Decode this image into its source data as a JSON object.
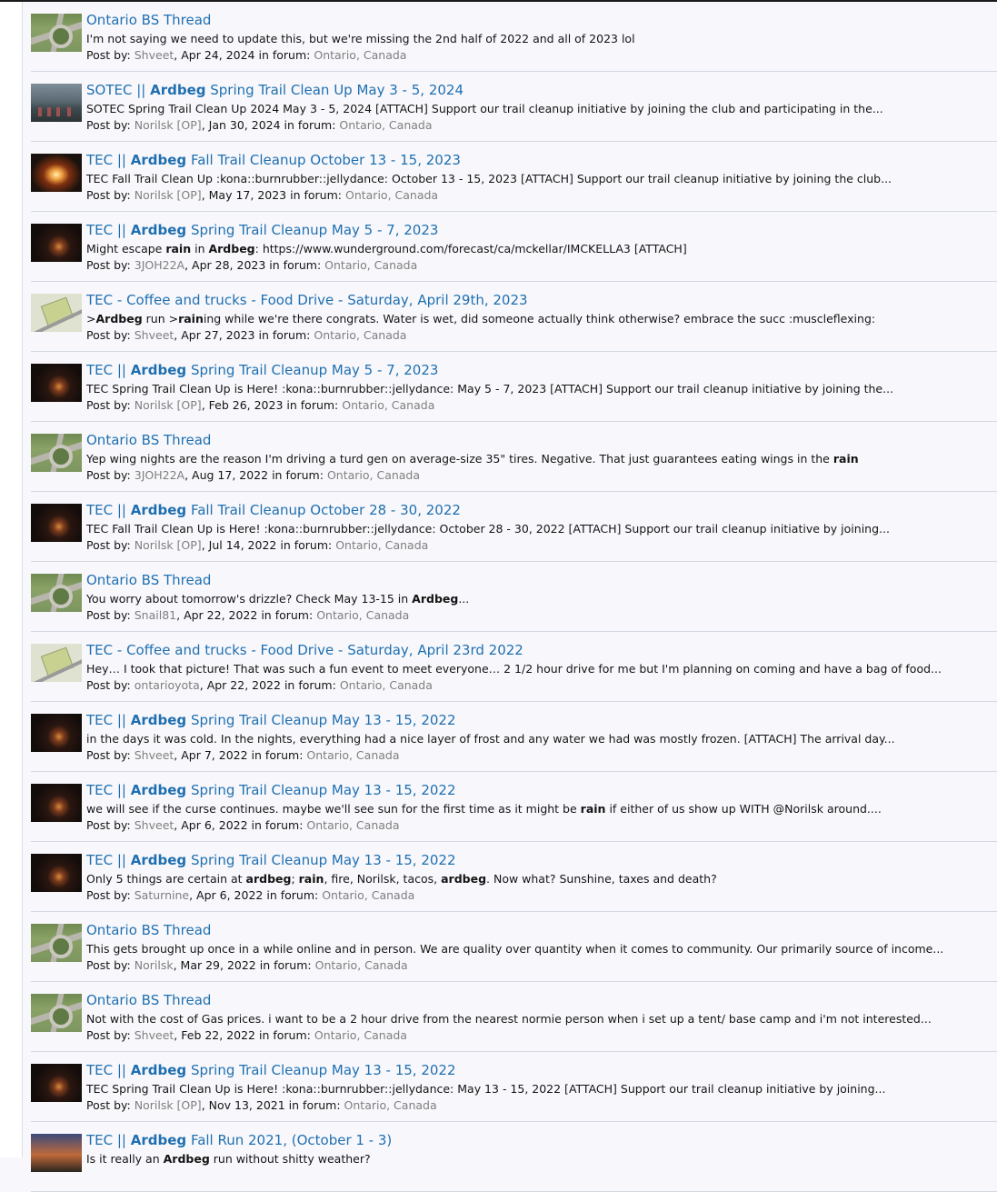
{
  "labels": {
    "post_by": "Post by:",
    "in_forum": "in forum:"
  },
  "colors": {
    "link": "#1f6fb0",
    "muted": "#7f7f7f",
    "text": "#141414",
    "divider": "#d3d8e2"
  },
  "results": [
    {
      "thumb": "roundabout-aerial-thumbnail",
      "title": [
        {
          "t": "Ontario BS Thread"
        }
      ],
      "snippet": [
        {
          "t": "I'm not saying we need to update this, but we're missing the 2nd half of 2022 and all of 2023 lol"
        }
      ],
      "author": "Shveet",
      "date": ", Apr 24, 2024",
      "forum": "Ontario, Canada"
    },
    {
      "thumb": "group-photo-thumbnail",
      "title": [
        {
          "t": "SOTEC || "
        },
        {
          "t": "Ardbeg",
          "b": true
        },
        {
          "t": " Spring Trail Clean Up May 3 - 5, 2024"
        }
      ],
      "snippet": [
        {
          "t": "SOTEC Spring Trail Clean Up 2024 May 3 - 5, 2024 [ATTACH] Support our trail cleanup initiative by joining the club and participating in the..."
        }
      ],
      "author": "Norilsk [OP]",
      "date": ", Jan 30, 2024",
      "forum": "Ontario, Canada"
    },
    {
      "thumb": "bonfire-thumbnail",
      "title": [
        {
          "t": "TEC || "
        },
        {
          "t": "Ardbeg",
          "b": true
        },
        {
          "t": " Fall Trail Cleanup October 13 - 15, 2023"
        }
      ],
      "snippet": [
        {
          "t": "TEC Fall Trail Clean Up :kona::burnrubber::jellydance: October 13 - 15, 2023 [ATTACH] Support our trail cleanup initiative by joining the club..."
        }
      ],
      "author": "Norilsk [OP]",
      "date": ", May 17, 2023",
      "forum": "Ontario, Canada"
    },
    {
      "thumb": "campfire-night-thumbnail",
      "title": [
        {
          "t": "TEC || "
        },
        {
          "t": "Ardbeg",
          "b": true
        },
        {
          "t": " Spring Trail Cleanup May 5 - 7, 2023"
        }
      ],
      "snippet": [
        {
          "t": "Might escape "
        },
        {
          "t": "rain",
          "b": true
        },
        {
          "t": " in "
        },
        {
          "t": "Ardbeg",
          "b": true
        },
        {
          "t": ": https://www.wunderground.com/forecast/ca/mckellar/IMCKELLA3 [ATTACH]"
        }
      ],
      "author": "3JOH22A",
      "date": ", Apr 28, 2023",
      "forum": "Ontario, Canada"
    },
    {
      "thumb": "map-thumbnail",
      "title": [
        {
          "t": "TEC - Coffee and trucks - Food Drive - Saturday, April 29th, 2023"
        }
      ],
      "snippet": [
        {
          "t": ">"
        },
        {
          "t": "Ardbeg",
          "b": true
        },
        {
          "t": " run >"
        },
        {
          "t": "rain",
          "b": true
        },
        {
          "t": "ing while we're there congrats. Water is wet, did someone actually think otherwise? embrace the succ :muscleflexing:"
        }
      ],
      "author": "Shveet",
      "date": ", Apr 27, 2023",
      "forum": "Ontario, Canada"
    },
    {
      "thumb": "campfire-night-thumbnail",
      "title": [
        {
          "t": "TEC || "
        },
        {
          "t": "Ardbeg",
          "b": true
        },
        {
          "t": " Spring Trail Cleanup May 5 - 7, 2023"
        }
      ],
      "snippet": [
        {
          "t": "TEC Spring Trail Clean Up is Here! :kona::burnrubber::jellydance: May 5 - 7, 2023 [ATTACH] Support our trail cleanup initiative by joining the..."
        }
      ],
      "author": "Norilsk [OP]",
      "date": ", Feb 26, 2023",
      "forum": "Ontario, Canada"
    },
    {
      "thumb": "roundabout-aerial-thumbnail",
      "title": [
        {
          "t": "Ontario BS Thread"
        }
      ],
      "snippet": [
        {
          "t": "Yep wing nights are the reason I'm driving a turd gen on average-size 35\" tires. Negative. That just guarantees eating wings in the "
        },
        {
          "t": "rain",
          "b": true
        }
      ],
      "author": "3JOH22A",
      "date": ", Aug 17, 2022",
      "forum": "Ontario, Canada"
    },
    {
      "thumb": "campfire-night-thumbnail",
      "title": [
        {
          "t": "TEC || "
        },
        {
          "t": "Ardbeg",
          "b": true
        },
        {
          "t": " Fall Trail Cleanup October 28 - 30, 2022"
        }
      ],
      "snippet": [
        {
          "t": "TEC Fall Trail Clean Up is Here! :kona::burnrubber::jellydance: October 28 - 30, 2022 [ATTACH] Support our trail cleanup initiative by joining..."
        }
      ],
      "author": "Norilsk [OP]",
      "date": ", Jul 14, 2022",
      "forum": "Ontario, Canada"
    },
    {
      "thumb": "roundabout-aerial-thumbnail",
      "title": [
        {
          "t": "Ontario BS Thread"
        }
      ],
      "snippet": [
        {
          "t": "You worry about tomorrow's drizzle? Check May 13-15 in "
        },
        {
          "t": "Ardbeg",
          "b": true
        },
        {
          "t": "..."
        }
      ],
      "author": "Snail81",
      "date": ", Apr 22, 2022",
      "forum": "Ontario, Canada"
    },
    {
      "thumb": "map-thumbnail",
      "title": [
        {
          "t": "TEC - Coffee and trucks - Food Drive - Saturday, April 23rd 2022"
        }
      ],
      "snippet": [
        {
          "t": "Hey… I took that picture! That was such a fun event to meet everyone… 2 1/2 hour drive for me but I'm planning on coming and have a bag of food..."
        }
      ],
      "author": "ontarioyota",
      "date": ", Apr 22, 2022",
      "forum": "Ontario, Canada"
    },
    {
      "thumb": "campfire-night-thumbnail",
      "title": [
        {
          "t": "TEC || "
        },
        {
          "t": "Ardbeg",
          "b": true
        },
        {
          "t": " Spring Trail Cleanup May 13 - 15, 2022"
        }
      ],
      "snippet": [
        {
          "t": "in the days it was cold. In the nights, everything had a nice layer of frost and any water we had was mostly frozen. [ATTACH] The arrival day..."
        }
      ],
      "author": "Shveet",
      "date": ", Apr 7, 2022",
      "forum": "Ontario, Canada"
    },
    {
      "thumb": "campfire-night-thumbnail",
      "title": [
        {
          "t": "TEC || "
        },
        {
          "t": "Ardbeg",
          "b": true
        },
        {
          "t": " Spring Trail Cleanup May 13 - 15, 2022"
        }
      ],
      "snippet": [
        {
          "t": "we will see if the curse continues. maybe we'll see sun for the first time as it might be "
        },
        {
          "t": "rain",
          "b": true
        },
        {
          "t": " if either of us show up WITH @Norilsk around...."
        }
      ],
      "author": "Shveet",
      "date": ", Apr 6, 2022",
      "forum": "Ontario, Canada"
    },
    {
      "thumb": "campfire-night-thumbnail",
      "title": [
        {
          "t": "TEC || "
        },
        {
          "t": "Ardbeg",
          "b": true
        },
        {
          "t": " Spring Trail Cleanup May 13 - 15, 2022"
        }
      ],
      "snippet": [
        {
          "t": "Only 5 things are certain at "
        },
        {
          "t": "ardbeg",
          "b": true
        },
        {
          "t": "; "
        },
        {
          "t": "rain",
          "b": true
        },
        {
          "t": ", fire, Norilsk, tacos, "
        },
        {
          "t": "ardbeg",
          "b": true
        },
        {
          "t": ". Now what? Sunshine, taxes and death?"
        }
      ],
      "author": "Saturnine",
      "date": ", Apr 6, 2022",
      "forum": "Ontario, Canada"
    },
    {
      "thumb": "roundabout-aerial-thumbnail",
      "title": [
        {
          "t": "Ontario BS Thread"
        }
      ],
      "snippet": [
        {
          "t": "This gets brought up once in a while online and in person. We are quality over quantity when it comes to community. Our primarily source of income..."
        }
      ],
      "author": "Norilsk",
      "date": ", Mar 29, 2022",
      "forum": "Ontario, Canada"
    },
    {
      "thumb": "roundabout-aerial-thumbnail",
      "title": [
        {
          "t": "Ontario BS Thread"
        }
      ],
      "snippet": [
        {
          "t": "Not with the cost of Gas prices. i want to be a 2 hour drive from the nearest normie person when i set up a tent/ base camp and i'm not interested..."
        }
      ],
      "author": "Shveet",
      "date": ", Feb 22, 2022",
      "forum": "Ontario, Canada"
    },
    {
      "thumb": "campfire-night-thumbnail",
      "title": [
        {
          "t": "TEC || "
        },
        {
          "t": "Ardbeg",
          "b": true
        },
        {
          "t": " Spring Trail Cleanup May 13 - 15, 2022"
        }
      ],
      "snippet": [
        {
          "t": "TEC Spring Trail Clean Up is Here! :kona::burnrubber::jellydance: May 13 - 15, 2022 [ATTACH] Support our trail cleanup initiative by joining..."
        }
      ],
      "author": "Norilsk [OP]",
      "date": ", Nov 13, 2021",
      "forum": "Ontario, Canada"
    },
    {
      "thumb": "sunset-thumbnail",
      "title": [
        {
          "t": "TEC || "
        },
        {
          "t": "Ardbeg",
          "b": true
        },
        {
          "t": " Fall Run 2021, (October 1 - 3)"
        }
      ],
      "snippet": [
        {
          "t": "Is it really an "
        },
        {
          "t": "Ardbeg",
          "b": true
        },
        {
          "t": " run without shitty weather?"
        }
      ],
      "author": "",
      "date": "",
      "forum": ""
    }
  ]
}
